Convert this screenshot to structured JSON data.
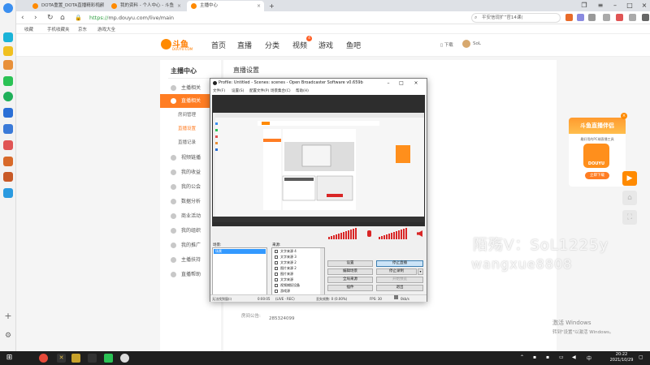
{
  "browser": {
    "tabs": [
      {
        "title": "DOTA重置_DOTA直播精彩视频",
        "active": false
      },
      {
        "title": "我的资料 - 个人中心 - 斗鱼",
        "active": false
      },
      {
        "title": "主播中心",
        "active": true
      }
    ],
    "url_secure": "https://",
    "url": "mp.douyu.com/live/main",
    "search_placeholder": "平安信现扩”官14课(",
    "bookmarks": [
      "收藏",
      "手机收藏夹",
      "京东",
      "游戏大全"
    ]
  },
  "site": {
    "logo_text": "斗鱼",
    "logo_sub": "DOUYU.COM",
    "nav": [
      {
        "label": "首页"
      },
      {
        "label": "直播"
      },
      {
        "label": "分类"
      },
      {
        "label": "视频",
        "badge": "4"
      },
      {
        "label": "游戏"
      },
      {
        "label": "鱼吧"
      }
    ],
    "download": "下载",
    "username": "SoL",
    "sidebar_title": "主播中心",
    "sidebar_items": [
      {
        "label": "主播相关",
        "active": false
      },
      {
        "label": "直播相关",
        "active": true
      },
      {
        "label": "房间管理",
        "sub": true
      },
      {
        "label": "直播设置",
        "sub": true,
        "on": true
      },
      {
        "label": "直播记录",
        "sub": true
      },
      {
        "label": "视频链播",
        "active": false
      },
      {
        "label": "我的收益",
        "active": false
      },
      {
        "label": "我的公会",
        "active": false
      },
      {
        "label": "数据分析",
        "active": false
      },
      {
        "label": "商业活动",
        "active": false
      },
      {
        "label": "我的组织",
        "active": false
      },
      {
        "label": "我的推广",
        "active": false
      },
      {
        "label": "主播扶持",
        "active": false
      },
      {
        "label": "直播帮助",
        "active": false
      }
    ],
    "content_title": "直播设置",
    "content_row_label": "房间公告:",
    "content_row_value": "285324099"
  },
  "promo": {
    "title": "斗鱼直播伴侣",
    "sub": "最好用的PC端直播工具",
    "app": "DOUYU",
    "button": "立即下载"
  },
  "watermark": {
    "line1": "陌殇V：SoL1225y",
    "line2": "wangxue8808"
  },
  "activation": {
    "title": "激活 Windows",
    "sub": "转到\"设置\"以激活 Windows。"
  },
  "obs": {
    "title": "Profile: Untitled - Scenes: scenes - Open Broadcaster Software v0.659b",
    "menu": [
      "文件(F)",
      "设置(S)",
      "配置文件(P)",
      "场景集合(C)",
      "帮助(H)"
    ],
    "scenes_label": "场景:",
    "sources_label": "来源:",
    "scene_selected": "场景",
    "sources": [
      "文字来源 4",
      "文字来源 3",
      "文字来源 2",
      "图片来源 2",
      "图片来源",
      "文字来源",
      "视频捕捉设备",
      "游戏源"
    ],
    "buttons": {
      "settings": "设置",
      "stop_live": "停止直播",
      "edit_scene": "编辑场景",
      "stop_recording": "停止录制",
      "global_sources": "全局来源",
      "preview": "开始预览",
      "plugins": "插件",
      "exit": "退出"
    },
    "status": {
      "status_text": "无法找到窗口",
      "time": "0:00:05",
      "bitrate": "(LIVE · REC)",
      "dropped": "丢失帧数: 0 (0.00%)",
      "fps": "FPS: 30",
      "kbps": "0kb/s"
    }
  },
  "taskbar": {
    "time": "20:22",
    "date": "2021/10/29",
    "lang": "中"
  },
  "colors": {
    "accent": "#ff7d23",
    "meter": "#d92626",
    "taskbar": "#1f1f1f"
  }
}
